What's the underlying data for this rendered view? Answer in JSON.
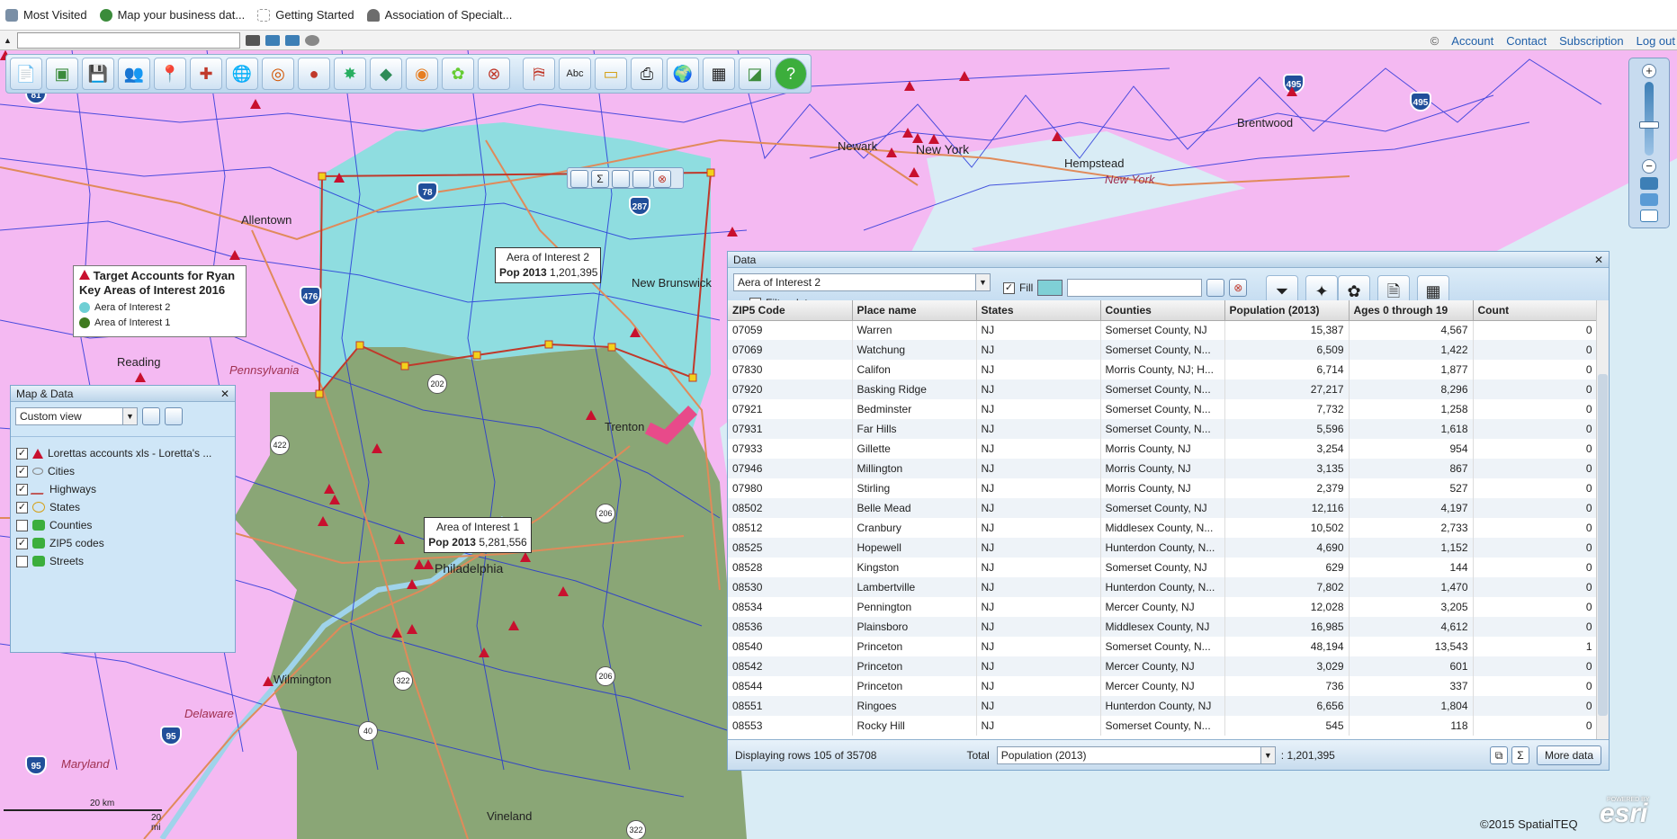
{
  "bookmarks": [
    {
      "label": "Most Visited",
      "icon": "gear-icon"
    },
    {
      "label": "Map your business dat...",
      "icon": "globe-icon"
    },
    {
      "label": "Getting Started",
      "icon": "page-icon"
    },
    {
      "label": "Association of Specialt...",
      "icon": "parachute-icon"
    }
  ],
  "address": {
    "value": ""
  },
  "top_links": {
    "copyright_symbol": "©",
    "account": "Account",
    "contact": "Contact",
    "subscription": "Subscription",
    "logout": "Log out"
  },
  "map": {
    "place_labels": {
      "allentown": "Allentown",
      "reading": "Reading",
      "new_brunswick": "New Brunswick",
      "trenton": "Trenton",
      "philadelphia": "Philadelphia",
      "wilmington": "Wilmington",
      "vineland": "Vineland",
      "newark": "Newark",
      "new_york": "New York",
      "hempstead": "Hempstead",
      "brentwood": "Brentwood"
    },
    "state_labels": {
      "pennsylvania": "Pennsylvania",
      "delaware": "Delaware",
      "maryland": "Maryland",
      "new_york_state": "New York"
    },
    "interstates": [
      "81",
      "476",
      "78",
      "287",
      "476",
      "95",
      "95",
      "495",
      "495"
    ],
    "us_routes": [
      "202",
      "422",
      "206",
      "206",
      "322",
      "40",
      "322"
    ],
    "colors": {
      "area1": "#8aa676",
      "area2": "#8fdde0",
      "background": "#f4b9f2",
      "water": "#d9ecf5",
      "boundaries": "#1f2fd8",
      "points": "#c8102e"
    }
  },
  "legend": {
    "title_line1": "Target Accounts for Ryan",
    "title_line2": "Key Areas of Interest 2016",
    "items": [
      {
        "label": "Aera of Interest 2",
        "color": "#6ecfd4"
      },
      {
        "label": "Area of Interest 1",
        "color": "#3f7a1f"
      }
    ]
  },
  "callouts": {
    "area2": {
      "name": "Aera of Interest 2",
      "pop_label": "Pop 2013",
      "pop_value": "1,201,395"
    },
    "area1": {
      "name": "Area of Interest 1",
      "pop_label": "Pop 2013",
      "pop_value": "5,281,556"
    }
  },
  "map_panel": {
    "title": "Map & Data",
    "view": "Custom view",
    "layers": [
      {
        "label": "Lorettas accounts xls - Loretta's ...",
        "checked": true,
        "icon": "triangle-icon"
      },
      {
        "label": "Cities",
        "checked": true,
        "icon": "cities-icon"
      },
      {
        "label": "Highways",
        "checked": true,
        "icon": "highway-icon"
      },
      {
        "label": "States",
        "checked": true,
        "icon": "state-icon"
      },
      {
        "label": "Counties",
        "checked": false,
        "icon": "county-icon"
      },
      {
        "label": "ZIP5 codes",
        "checked": true,
        "icon": "zip-icon"
      },
      {
        "label": "Streets",
        "checked": false,
        "icon": "street-icon"
      }
    ]
  },
  "data_panel": {
    "title": "Data",
    "area_select": "Aera of Interest 2",
    "filter_label": "Filter data on map",
    "fill_label": "Fill",
    "fill_color": "#7fd0d6",
    "columns": [
      "ZIP5 Code",
      "Place name",
      "States",
      "Counties",
      "Population (2013)",
      "Ages 0 through 19",
      "Count"
    ],
    "rows": [
      [
        "07059",
        "Warren",
        "NJ",
        "Somerset County, NJ",
        "15,387",
        "4,567",
        "0"
      ],
      [
        "07069",
        "Watchung",
        "NJ",
        "Somerset County, N...",
        "6,509",
        "1,422",
        "0"
      ],
      [
        "07830",
        "Califon",
        "NJ",
        "Morris County, NJ; H...",
        "6,714",
        "1,877",
        "0"
      ],
      [
        "07920",
        "Basking Ridge",
        "NJ",
        "Somerset County, N...",
        "27,217",
        "8,296",
        "0"
      ],
      [
        "07921",
        "Bedminster",
        "NJ",
        "Somerset County, N...",
        "7,732",
        "1,258",
        "0"
      ],
      [
        "07931",
        "Far Hills",
        "NJ",
        "Somerset County, N...",
        "5,596",
        "1,618",
        "0"
      ],
      [
        "07933",
        "Gillette",
        "NJ",
        "Morris County, NJ",
        "3,254",
        "954",
        "0"
      ],
      [
        "07946",
        "Millington",
        "NJ",
        "Morris County, NJ",
        "3,135",
        "867",
        "0"
      ],
      [
        "07980",
        "Stirling",
        "NJ",
        "Morris County, NJ",
        "2,379",
        "527",
        "0"
      ],
      [
        "08502",
        "Belle Mead",
        "NJ",
        "Somerset County, NJ",
        "12,116",
        "4,197",
        "0"
      ],
      [
        "08512",
        "Cranbury",
        "NJ",
        "Middlesex County, N...",
        "10,502",
        "2,733",
        "0"
      ],
      [
        "08525",
        "Hopewell",
        "NJ",
        "Hunterdon County, N...",
        "4,690",
        "1,152",
        "0"
      ],
      [
        "08528",
        "Kingston",
        "NJ",
        "Somerset County, NJ",
        "629",
        "144",
        "0"
      ],
      [
        "08530",
        "Lambertville",
        "NJ",
        "Hunterdon County, N...",
        "7,802",
        "1,470",
        "0"
      ],
      [
        "08534",
        "Pennington",
        "NJ",
        "Mercer County, NJ",
        "12,028",
        "3,205",
        "0"
      ],
      [
        "08536",
        "Plainsboro",
        "NJ",
        "Middlesex County, NJ",
        "16,985",
        "4,612",
        "0"
      ],
      [
        "08540",
        "Princeton",
        "NJ",
        "Somerset County, N...",
        "48,194",
        "13,543",
        "1"
      ],
      [
        "08542",
        "Princeton",
        "NJ",
        "Mercer County, NJ",
        "3,029",
        "601",
        "0"
      ],
      [
        "08544",
        "Princeton",
        "NJ",
        "Mercer County, NJ",
        "736",
        "337",
        "0"
      ],
      [
        "08551",
        "Ringoes",
        "NJ",
        "Hunterdon County, NJ",
        "6,656",
        "1,804",
        "0"
      ],
      [
        "08553",
        "Rocky Hill",
        "NJ",
        "Somerset County, N...",
        "545",
        "118",
        "0"
      ]
    ],
    "status": "Displaying rows 105 of 35708",
    "total_label": "Total",
    "total_field": "Population (2013)",
    "total_value": ": 1,201,395",
    "more_button": "More data"
  },
  "scale": {
    "km": "20 km",
    "mi": "20 mi"
  },
  "copyright": "©2015 SpatialTEQ",
  "esri": {
    "powered": "POWERED BY",
    "brand": "esri"
  }
}
